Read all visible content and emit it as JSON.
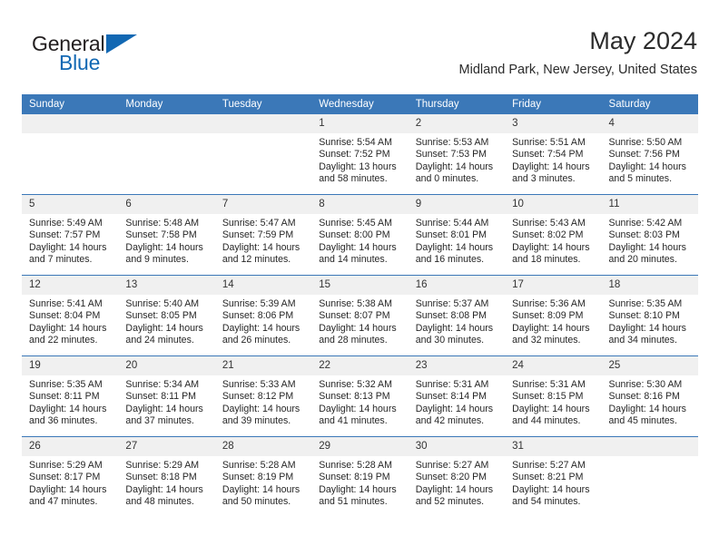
{
  "brand": {
    "word_general": "General",
    "word_blue": "Blue",
    "triangle_color": "#1268b3"
  },
  "header": {
    "title": "May 2024",
    "subtitle": "Midland Park, New Jersey, United States"
  },
  "colors": {
    "header_blue": "#3b78b8",
    "daynum_background": "#f0f0f0",
    "text": "#262626"
  },
  "weekday_headers": [
    "Sunday",
    "Monday",
    "Tuesday",
    "Wednesday",
    "Thursday",
    "Friday",
    "Saturday"
  ],
  "weeks": [
    [
      {
        "empty": true,
        "day": ""
      },
      {
        "empty": true,
        "day": ""
      },
      {
        "empty": true,
        "day": ""
      },
      {
        "empty": false,
        "day": "1",
        "sunrise": "Sunrise: 5:54 AM",
        "sunset": "Sunset: 7:52 PM",
        "daylight_line1": "Daylight: 13 hours",
        "daylight_line2": "and 58 minutes."
      },
      {
        "empty": false,
        "day": "2",
        "sunrise": "Sunrise: 5:53 AM",
        "sunset": "Sunset: 7:53 PM",
        "daylight_line1": "Daylight: 14 hours",
        "daylight_line2": "and 0 minutes."
      },
      {
        "empty": false,
        "day": "3",
        "sunrise": "Sunrise: 5:51 AM",
        "sunset": "Sunset: 7:54 PM",
        "daylight_line1": "Daylight: 14 hours",
        "daylight_line2": "and 3 minutes."
      },
      {
        "empty": false,
        "day": "4",
        "sunrise": "Sunrise: 5:50 AM",
        "sunset": "Sunset: 7:56 PM",
        "daylight_line1": "Daylight: 14 hours",
        "daylight_line2": "and 5 minutes."
      }
    ],
    [
      {
        "empty": false,
        "day": "5",
        "sunrise": "Sunrise: 5:49 AM",
        "sunset": "Sunset: 7:57 PM",
        "daylight_line1": "Daylight: 14 hours",
        "daylight_line2": "and 7 minutes."
      },
      {
        "empty": false,
        "day": "6",
        "sunrise": "Sunrise: 5:48 AM",
        "sunset": "Sunset: 7:58 PM",
        "daylight_line1": "Daylight: 14 hours",
        "daylight_line2": "and 9 minutes."
      },
      {
        "empty": false,
        "day": "7",
        "sunrise": "Sunrise: 5:47 AM",
        "sunset": "Sunset: 7:59 PM",
        "daylight_line1": "Daylight: 14 hours",
        "daylight_line2": "and 12 minutes."
      },
      {
        "empty": false,
        "day": "8",
        "sunrise": "Sunrise: 5:45 AM",
        "sunset": "Sunset: 8:00 PM",
        "daylight_line1": "Daylight: 14 hours",
        "daylight_line2": "and 14 minutes."
      },
      {
        "empty": false,
        "day": "9",
        "sunrise": "Sunrise: 5:44 AM",
        "sunset": "Sunset: 8:01 PM",
        "daylight_line1": "Daylight: 14 hours",
        "daylight_line2": "and 16 minutes."
      },
      {
        "empty": false,
        "day": "10",
        "sunrise": "Sunrise: 5:43 AM",
        "sunset": "Sunset: 8:02 PM",
        "daylight_line1": "Daylight: 14 hours",
        "daylight_line2": "and 18 minutes."
      },
      {
        "empty": false,
        "day": "11",
        "sunrise": "Sunrise: 5:42 AM",
        "sunset": "Sunset: 8:03 PM",
        "daylight_line1": "Daylight: 14 hours",
        "daylight_line2": "and 20 minutes."
      }
    ],
    [
      {
        "empty": false,
        "day": "12",
        "sunrise": "Sunrise: 5:41 AM",
        "sunset": "Sunset: 8:04 PM",
        "daylight_line1": "Daylight: 14 hours",
        "daylight_line2": "and 22 minutes."
      },
      {
        "empty": false,
        "day": "13",
        "sunrise": "Sunrise: 5:40 AM",
        "sunset": "Sunset: 8:05 PM",
        "daylight_line1": "Daylight: 14 hours",
        "daylight_line2": "and 24 minutes."
      },
      {
        "empty": false,
        "day": "14",
        "sunrise": "Sunrise: 5:39 AM",
        "sunset": "Sunset: 8:06 PM",
        "daylight_line1": "Daylight: 14 hours",
        "daylight_line2": "and 26 minutes."
      },
      {
        "empty": false,
        "day": "15",
        "sunrise": "Sunrise: 5:38 AM",
        "sunset": "Sunset: 8:07 PM",
        "daylight_line1": "Daylight: 14 hours",
        "daylight_line2": "and 28 minutes."
      },
      {
        "empty": false,
        "day": "16",
        "sunrise": "Sunrise: 5:37 AM",
        "sunset": "Sunset: 8:08 PM",
        "daylight_line1": "Daylight: 14 hours",
        "daylight_line2": "and 30 minutes."
      },
      {
        "empty": false,
        "day": "17",
        "sunrise": "Sunrise: 5:36 AM",
        "sunset": "Sunset: 8:09 PM",
        "daylight_line1": "Daylight: 14 hours",
        "daylight_line2": "and 32 minutes."
      },
      {
        "empty": false,
        "day": "18",
        "sunrise": "Sunrise: 5:35 AM",
        "sunset": "Sunset: 8:10 PM",
        "daylight_line1": "Daylight: 14 hours",
        "daylight_line2": "and 34 minutes."
      }
    ],
    [
      {
        "empty": false,
        "day": "19",
        "sunrise": "Sunrise: 5:35 AM",
        "sunset": "Sunset: 8:11 PM",
        "daylight_line1": "Daylight: 14 hours",
        "daylight_line2": "and 36 minutes."
      },
      {
        "empty": false,
        "day": "20",
        "sunrise": "Sunrise: 5:34 AM",
        "sunset": "Sunset: 8:11 PM",
        "daylight_line1": "Daylight: 14 hours",
        "daylight_line2": "and 37 minutes."
      },
      {
        "empty": false,
        "day": "21",
        "sunrise": "Sunrise: 5:33 AM",
        "sunset": "Sunset: 8:12 PM",
        "daylight_line1": "Daylight: 14 hours",
        "daylight_line2": "and 39 minutes."
      },
      {
        "empty": false,
        "day": "22",
        "sunrise": "Sunrise: 5:32 AM",
        "sunset": "Sunset: 8:13 PM",
        "daylight_line1": "Daylight: 14 hours",
        "daylight_line2": "and 41 minutes."
      },
      {
        "empty": false,
        "day": "23",
        "sunrise": "Sunrise: 5:31 AM",
        "sunset": "Sunset: 8:14 PM",
        "daylight_line1": "Daylight: 14 hours",
        "daylight_line2": "and 42 minutes."
      },
      {
        "empty": false,
        "day": "24",
        "sunrise": "Sunrise: 5:31 AM",
        "sunset": "Sunset: 8:15 PM",
        "daylight_line1": "Daylight: 14 hours",
        "daylight_line2": "and 44 minutes."
      },
      {
        "empty": false,
        "day": "25",
        "sunrise": "Sunrise: 5:30 AM",
        "sunset": "Sunset: 8:16 PM",
        "daylight_line1": "Daylight: 14 hours",
        "daylight_line2": "and 45 minutes."
      }
    ],
    [
      {
        "empty": false,
        "day": "26",
        "sunrise": "Sunrise: 5:29 AM",
        "sunset": "Sunset: 8:17 PM",
        "daylight_line1": "Daylight: 14 hours",
        "daylight_line2": "and 47 minutes."
      },
      {
        "empty": false,
        "day": "27",
        "sunrise": "Sunrise: 5:29 AM",
        "sunset": "Sunset: 8:18 PM",
        "daylight_line1": "Daylight: 14 hours",
        "daylight_line2": "and 48 minutes."
      },
      {
        "empty": false,
        "day": "28",
        "sunrise": "Sunrise: 5:28 AM",
        "sunset": "Sunset: 8:19 PM",
        "daylight_line1": "Daylight: 14 hours",
        "daylight_line2": "and 50 minutes."
      },
      {
        "empty": false,
        "day": "29",
        "sunrise": "Sunrise: 5:28 AM",
        "sunset": "Sunset: 8:19 PM",
        "daylight_line1": "Daylight: 14 hours",
        "daylight_line2": "and 51 minutes."
      },
      {
        "empty": false,
        "day": "30",
        "sunrise": "Sunrise: 5:27 AM",
        "sunset": "Sunset: 8:20 PM",
        "daylight_line1": "Daylight: 14 hours",
        "daylight_line2": "and 52 minutes."
      },
      {
        "empty": false,
        "day": "31",
        "sunrise": "Sunrise: 5:27 AM",
        "sunset": "Sunset: 8:21 PM",
        "daylight_line1": "Daylight: 14 hours",
        "daylight_line2": "and 54 minutes."
      },
      {
        "empty": true,
        "day": ""
      }
    ]
  ]
}
